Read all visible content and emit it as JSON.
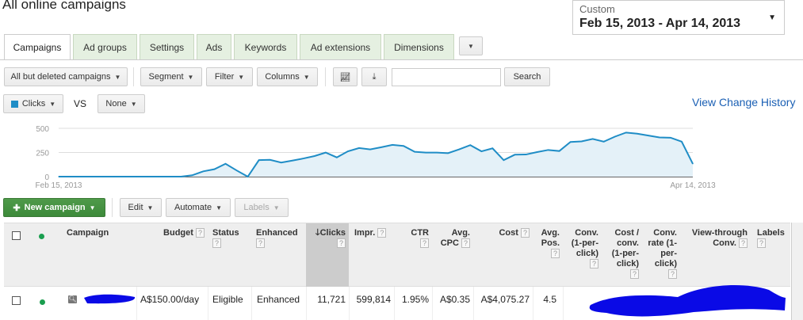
{
  "header": {
    "title": "All online campaigns",
    "date_label": "Custom",
    "date_range": "Feb 15, 2013 - Apr 14, 2013"
  },
  "tabs": [
    {
      "label": "Campaigns"
    },
    {
      "label": "Ad groups"
    },
    {
      "label": "Settings"
    },
    {
      "label": "Ads"
    },
    {
      "label": "Keywords"
    },
    {
      "label": "Ad extensions"
    },
    {
      "label": "Dimensions"
    }
  ],
  "toolbar": {
    "filter_campaigns": "All but deleted campaigns",
    "segment": "Segment",
    "filter": "Filter",
    "columns": "Columns",
    "search_value": "",
    "search": "Search"
  },
  "chart_controls": {
    "metric1": "Clicks",
    "vs": "VS",
    "metric2": "None",
    "view_change_history": "View Change History"
  },
  "chart_data": {
    "type": "area",
    "title": "",
    "xlabel": "",
    "ylabel": "Clicks",
    "ylim": [
      0,
      500
    ],
    "yticks": [
      "0",
      "250",
      "500"
    ],
    "x_start_label": "Feb 15, 2013",
    "x_end_label": "Apr 14, 2013",
    "series": [
      {
        "name": "Clicks",
        "color": "#1f8dc6",
        "values": [
          0,
          0,
          0,
          0,
          0,
          0,
          0,
          0,
          0,
          0,
          0,
          0,
          14,
          55,
          77,
          133,
          64,
          0,
          171,
          174,
          146,
          166,
          188,
          213,
          249,
          199,
          262,
          296,
          282,
          304,
          329,
          318,
          257,
          249,
          249,
          243,
          282,
          326,
          262,
          293,
          171,
          227,
          229,
          254,
          276,
          265,
          359,
          365,
          390,
          362,
          414,
          456,
          445,
          425,
          406,
          403,
          362,
          133
        ]
      }
    ]
  },
  "actions": {
    "new_campaign": "New campaign",
    "edit": "Edit",
    "automate": "Automate",
    "labels": "Labels"
  },
  "table": {
    "columns": {
      "campaign": "Campaign",
      "budget": "Budget",
      "status": "Status",
      "enhanced": "Enhanced",
      "clicks": "Clicks",
      "impr": "Impr.",
      "ctr": "CTR",
      "avg_cpc": "Avg. CPC",
      "cost": "Cost",
      "avg_pos": "Avg. Pos.",
      "conv": "Conv. (1-per-click)",
      "cost_conv": "Cost / conv. (1-per-click)",
      "conv_rate": "Conv. rate (1-per-click)",
      "view_through": "View-through Conv.",
      "labels": "Labels"
    },
    "help": "?",
    "rows": [
      {
        "budget": "A$150.00/day",
        "status": "Eligible",
        "enhanced": "Enhanced",
        "clicks": "11,721",
        "impr": "599,814",
        "ctr": "1.95%",
        "avg_cpc": "A$0.35",
        "cost": "A$4,075.27",
        "avg_pos": "4.5"
      }
    ]
  }
}
